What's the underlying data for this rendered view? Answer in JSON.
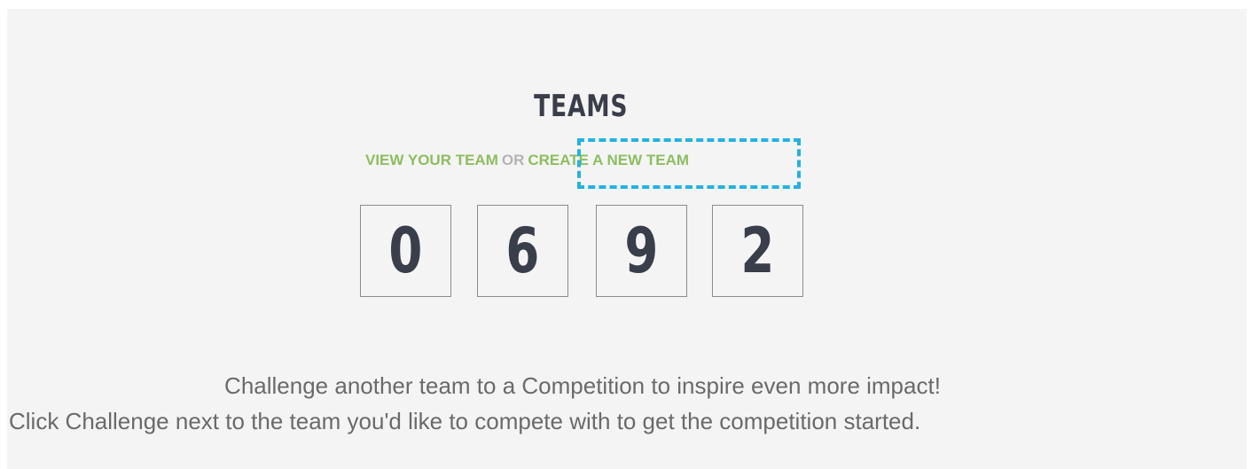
{
  "section": {
    "title": "TEAMS"
  },
  "links": {
    "view_team": "VIEW YOUR TEAM",
    "separator": "OR",
    "create_team": "CREATE A NEW TEAM"
  },
  "counter": {
    "digits": [
      "0",
      "6",
      "9",
      "2"
    ]
  },
  "message": {
    "line1": "Challenge another team to a Competition to inspire even more impact!",
    "line2": "Click Challenge next to the team you'd like to compete with to get the competition started."
  },
  "colors": {
    "link": "#8cbe5f",
    "separator": "#b4b4b4",
    "highlight": "#1fb3e6",
    "title": "#3a3d4a",
    "body_text": "#6a6a6a",
    "panel_bg": "#f4f4f4"
  }
}
